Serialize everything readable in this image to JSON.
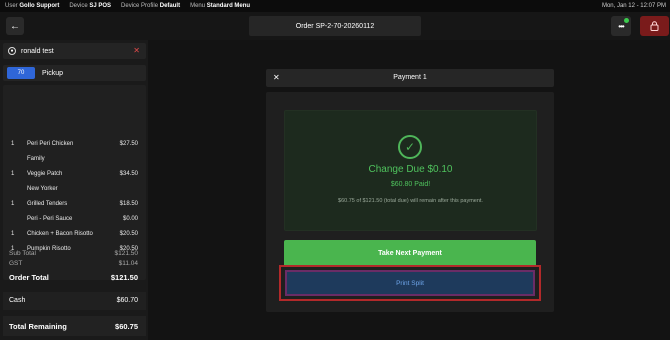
{
  "topbar": {
    "user_label": "User",
    "user_value": "Gollo Support",
    "device_label": "Device",
    "device_value": "SJ POS",
    "profile_label": "Device Profile",
    "profile_value": "Default",
    "menu_label": "Menu",
    "menu_value": "Standard Menu",
    "clock": "Mon, Jan 12 - 12:07 PM"
  },
  "header": {
    "order_title": "Order SP-2-70-20260112"
  },
  "customer": {
    "name": "ronald test"
  },
  "order_type": {
    "number": "70",
    "label": "Pickup"
  },
  "items": [
    {
      "qty": "1",
      "name": "Peri Peri Chicken",
      "price": "$27.50"
    },
    {
      "qty": "",
      "name": "Family",
      "price": ""
    },
    {
      "qty": "1",
      "name": "Veggie Patch",
      "price": "$34.50"
    },
    {
      "qty": "",
      "name": "New Yorker",
      "price": ""
    },
    {
      "qty": "1",
      "name": "Grilled Tenders",
      "price": "$18.50"
    },
    {
      "qty": "",
      "name": "Peri - Peri Sauce",
      "price": "$0.00"
    },
    {
      "qty": "1",
      "name": "Chicken + Bacon Risotto",
      "price": "$20.50"
    },
    {
      "qty": "1",
      "name": "Pumpkin Risotto",
      "price": "$20.50"
    }
  ],
  "totals": {
    "subtotal_label": "Sub Total",
    "subtotal_value": "$121.50",
    "gst_label": "GST",
    "gst_value": "$11.04",
    "order_total_label": "Order Total",
    "order_total_value": "$121.50",
    "cash_label": "Cash",
    "cash_value": "$60.70",
    "remaining_label": "Total Remaining",
    "remaining_value": "$60.75"
  },
  "modal": {
    "title": "Payment 1",
    "change_due": "Change Due $0.10",
    "paid": "$60.80 Paid!",
    "note": "$60.75 of $121.50 (total due) will remain after this payment.",
    "next_payment_label": "Take Next Payment",
    "print_split_label": "Print Split"
  },
  "icons": {
    "back": "arrow-left-icon",
    "more": "more-dots-icon",
    "lock": "lock-icon",
    "user": "user-icon",
    "close": "close-icon",
    "check": "check-circle-icon"
  },
  "colors": {
    "accent_green": "#4ab54e",
    "lock_red": "#7a1b1b",
    "pickup_blue": "#2f66d8",
    "highlight_red": "#b2292a"
  }
}
